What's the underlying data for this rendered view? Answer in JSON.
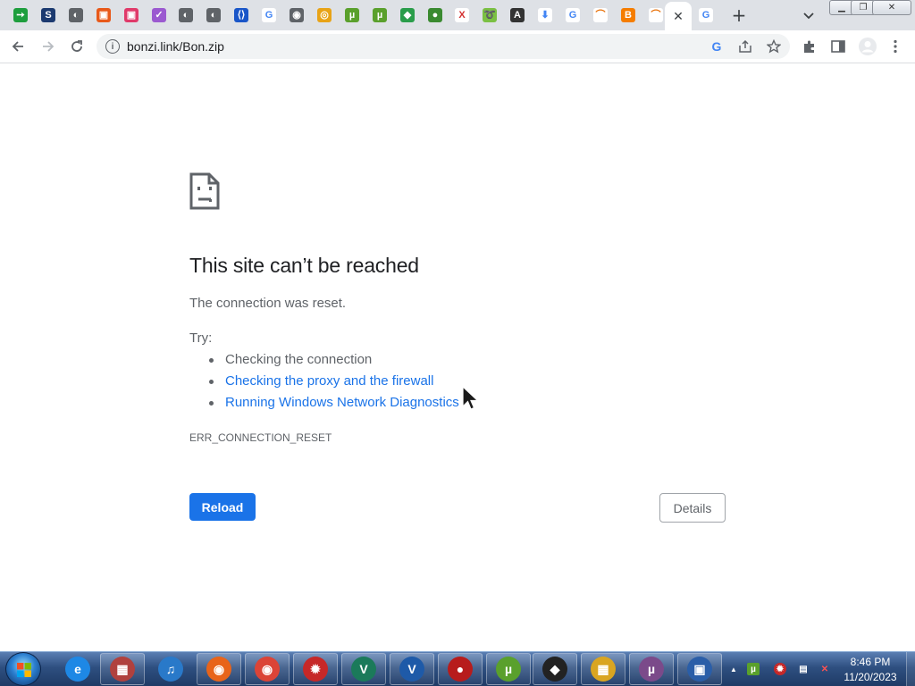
{
  "browser": {
    "tabs": [
      {
        "name": "green-arrow",
        "glyph": "➙",
        "bg": "#1e9e3e"
      },
      {
        "name": "letter-s",
        "glyph": "S",
        "bg": "#1c3a70"
      },
      {
        "name": "gray-globe",
        "glyph": "◐",
        "bg": "#5f6368"
      },
      {
        "name": "multicolor-square",
        "glyph": "▣",
        "bg": "#e8591a"
      },
      {
        "name": "multicolor-square-2",
        "glyph": "▣",
        "bg": "#e03a6a"
      },
      {
        "name": "purple-check",
        "glyph": "✓",
        "bg": "#9b59d0"
      },
      {
        "name": "gray-globe-2",
        "glyph": "◐",
        "bg": "#5f6368"
      },
      {
        "name": "gray-globe-3",
        "glyph": "◐",
        "bg": "#5f6368"
      },
      {
        "name": "blue-bracket",
        "glyph": "⟨⟩",
        "bg": "#1a56c8"
      },
      {
        "name": "google-g",
        "glyph": "G",
        "bg": "#ffffff"
      },
      {
        "name": "chrome",
        "glyph": "◉",
        "bg": "#5f6368"
      },
      {
        "name": "colorful-ring",
        "glyph": "◎",
        "bg": "#e8a317"
      },
      {
        "name": "utorrent",
        "glyph": "µ",
        "bg": "#5aa02c"
      },
      {
        "name": "utorrent-2",
        "glyph": "µ",
        "bg": "#5aa02c"
      },
      {
        "name": "green-shield",
        "glyph": "◆",
        "bg": "#2a9d4b"
      },
      {
        "name": "green-blob",
        "glyph": "●",
        "bg": "#3a8a30"
      },
      {
        "name": "red-x",
        "glyph": "X",
        "bg": "#ffffff"
      },
      {
        "name": "green-swirl",
        "glyph": "➰",
        "bg": "#7bc043"
      },
      {
        "name": "dark-circle",
        "glyph": "A",
        "bg": "#333333"
      },
      {
        "name": "blue-download",
        "glyph": "⬇",
        "bg": "#ffffff"
      },
      {
        "name": "google-g-2",
        "glyph": "G",
        "bg": "#ffffff"
      },
      {
        "name": "rainbow",
        "glyph": "⌒",
        "bg": "#ffffff"
      },
      {
        "name": "blogger",
        "glyph": "B",
        "bg": "#f57d00"
      },
      {
        "name": "rainbow-2",
        "glyph": "⌒",
        "bg": "#ffffff"
      },
      {
        "name": "google-g-3",
        "glyph": "G",
        "bg": "#ffffff"
      }
    ],
    "close_glyph": "✕",
    "newtab_glyph": "+",
    "tabsearch_glyph": "⌄",
    "window_buttons": {
      "minimize": "▁",
      "restore": "❐",
      "close": "✕"
    },
    "url": "bonzi.link/Bon.zip",
    "info_glyph": "i"
  },
  "error": {
    "title": "This site can’t be reached",
    "description": "The connection was reset.",
    "try_label": "Try:",
    "suggestions": [
      {
        "text": "Checking the connection",
        "link": false
      },
      {
        "text": "Checking the proxy and the firewall",
        "link": true
      },
      {
        "text": "Running Windows Network Diagnostics",
        "link": true
      }
    ],
    "code": "ERR_CONNECTION_RESET",
    "reload_label": "Reload",
    "details_label": "Details"
  },
  "taskbar": {
    "items": [
      {
        "name": "internet-explorer",
        "glyph": "e",
        "bg": "#1e88e5",
        "pinned": true
      },
      {
        "name": "gift-box",
        "glyph": "▦",
        "bg": "#b0413e",
        "pinned": false
      },
      {
        "name": "itunes-music",
        "glyph": "♫",
        "bg": "#2979c9",
        "pinned": true
      },
      {
        "name": "firefox",
        "glyph": "◉",
        "bg": "#e8641a",
        "pinned": false
      },
      {
        "name": "chrome",
        "glyph": "◉",
        "bg": "#db4437",
        "pinned": false
      },
      {
        "name": "red-gear-app",
        "glyph": "✹",
        "bg": "#c62828",
        "pinned": false
      },
      {
        "name": "green-v-app",
        "glyph": "V",
        "bg": "#1b7a5a",
        "pinned": false
      },
      {
        "name": "blue-shield-app",
        "glyph": "V",
        "bg": "#1e5aa8",
        "pinned": false
      },
      {
        "name": "red-camera-app",
        "glyph": "●",
        "bg": "#b71c1c",
        "pinned": false
      },
      {
        "name": "utorrent",
        "glyph": "µ",
        "bg": "#5aa02c",
        "pinned": false
      },
      {
        "name": "black-app",
        "glyph": "◆",
        "bg": "#222222",
        "pinned": false
      },
      {
        "name": "mosaic-app",
        "glyph": "▦",
        "bg": "#d9a521",
        "pinned": false
      },
      {
        "name": "utorrent-web",
        "glyph": "µ",
        "bg": "#7b4a8a",
        "pinned": false
      },
      {
        "name": "system-app",
        "glyph": "▣",
        "bg": "#2a5ea8",
        "pinned": false
      }
    ],
    "tray_glyphs": {
      "arrow": "▲",
      "utorrent": "µ",
      "security": "✹",
      "network": "▤",
      "volume": "✕"
    },
    "time": "8:46 PM",
    "date": "11/20/2023"
  },
  "colors": {
    "accent": "#1a73e8",
    "text": "#202124",
    "secondary": "#5f6368"
  }
}
